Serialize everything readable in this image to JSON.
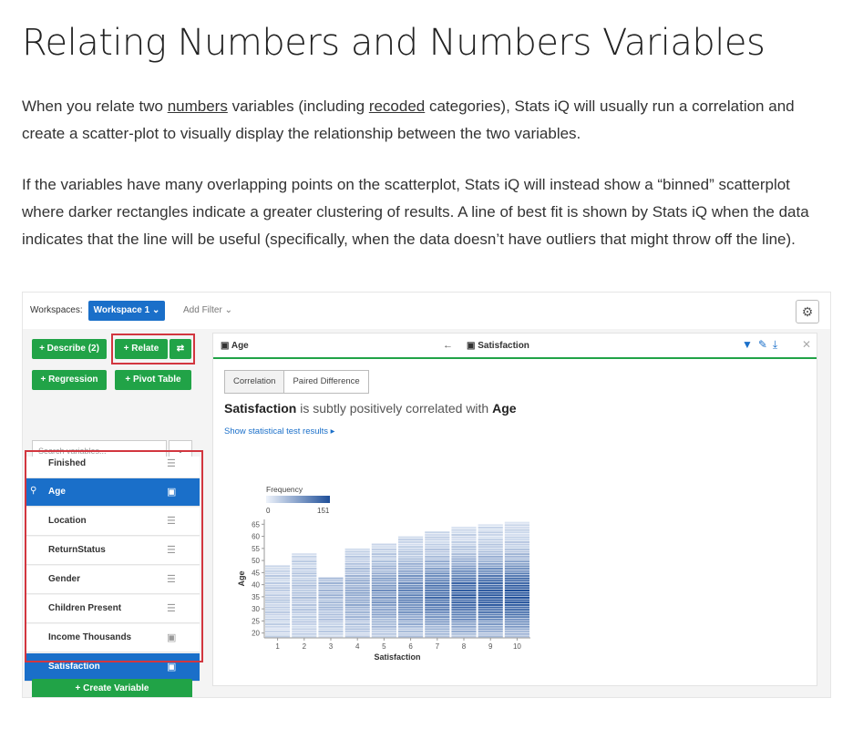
{
  "article": {
    "title": "Relating Numbers and Numbers Variables",
    "p1": {
      "t1": "When you relate two ",
      "link1": "numbers",
      "t2": " variables (including ",
      "link2": "recoded",
      "t3": " categories), Stats iQ will usually run a correlation and create a scatter-plot to visually display the relationship between the two variables."
    },
    "p2": "If the variables have many overlapping points on the scatterplot, Stats iQ will instead show a “binned” scatterplot where darker rectangles indicate a greater clustering of results. A line of best fit is shown by Stats iQ when the data indicates that the line will be useful (specifically, when the data doesn’t have outliers that might throw off the line)."
  },
  "app": {
    "workspaces_label": "Workspaces:",
    "workspace_button": "Workspace 1 ⌄",
    "add_filter": "Add Filter ⌄",
    "gear_icon": "⚙",
    "buttons": {
      "describe": "+ Describe (2)",
      "relate": "+ Relate",
      "swap_icon": "⇄",
      "regression": "+ Regression",
      "pivot": "+ Pivot Table",
      "create_variable": "+ Create Variable"
    },
    "search_placeholder": "Search variables...",
    "search_dd_icon": "⌄",
    "variables": [
      {
        "name": "Finished",
        "icon": "☰"
      },
      {
        "name": "Age",
        "icon": "▣"
      },
      {
        "name": "Location",
        "icon": "☰"
      },
      {
        "name": "ReturnStatus",
        "icon": "☰"
      },
      {
        "name": "Gender",
        "icon": "☰"
      },
      {
        "name": "Children Present",
        "icon": "☰"
      },
      {
        "name": "Income Thousands",
        "icon": "▣"
      },
      {
        "name": "Satisfaction",
        "icon": "▣"
      }
    ],
    "key_icon": "⚲",
    "main": {
      "left_var": "▣ Age",
      "arrow": "←",
      "right_var": "▣ Satisfaction",
      "tools": "▼✎⤓",
      "close": "✕",
      "tabs": [
        "Correlation",
        "Paired Difference"
      ],
      "headline_bold1": "Satisfaction",
      "headline_mid": " is subtly positively correlated with ",
      "headline_bold2": "Age",
      "stat_link": "Show statistical test results ▸"
    },
    "colors": {
      "accent_blue": "#1a6fc9",
      "green": "#21a347",
      "highlight_red": "#d2363f"
    }
  },
  "chart_data": {
    "type": "heatmap",
    "legend_title": "Frequency",
    "legend_min": "0",
    "legend_max": "151",
    "xlabel": "Satisfaction",
    "ylabel": "Age",
    "x_ticks": [
      "1",
      "2",
      "3",
      "4",
      "5",
      "6",
      "7",
      "8",
      "9",
      "10"
    ],
    "y_ticks": [
      "20",
      "25",
      "30",
      "35",
      "40",
      "45",
      "50",
      "55",
      "60",
      "65"
    ],
    "xlim": [
      0.5,
      10.5
    ],
    "ylim": [
      18,
      67
    ],
    "columns": [
      {
        "x": 1,
        "age_min": 18,
        "age_max": 48
      },
      {
        "x": 2,
        "age_min": 18,
        "age_max": 53
      },
      {
        "x": 3,
        "age_min": 18,
        "age_max": 43
      },
      {
        "x": 4,
        "age_min": 18,
        "age_max": 55
      },
      {
        "x": 5,
        "age_min": 18,
        "age_max": 57
      },
      {
        "x": 6,
        "age_min": 18,
        "age_max": 60
      },
      {
        "x": 7,
        "age_min": 18,
        "age_max": 62
      },
      {
        "x": 8,
        "age_min": 18,
        "age_max": 64
      },
      {
        "x": 9,
        "age_min": 18,
        "age_max": 65
      },
      {
        "x": 10,
        "age_min": 18,
        "age_max": 66
      }
    ],
    "density_peak": {
      "x": 10,
      "age": 35
    }
  }
}
